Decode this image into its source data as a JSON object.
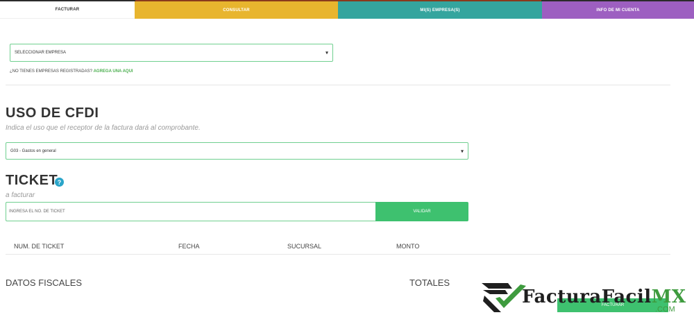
{
  "tabs": [
    {
      "label": "FACTURAR",
      "color": "#ffffff"
    },
    {
      "label": "CONSULTAR",
      "color": "#e8b52e"
    },
    {
      "label": "MI(S) EMPRESA(S)",
      "color": "#34a59e"
    },
    {
      "label": "INFO DE MI CUENTA",
      "color": "#9d5fc1"
    }
  ],
  "empresa": {
    "select_value": "SELECCIONAR EMPRESA",
    "no_empresas_text": "¿NO TIENES EMPRESAS REGISTRADAS?",
    "agrega_link": "AGREGA UNA AQUI"
  },
  "cfdi": {
    "title": "USO DE CFDI",
    "subtitle": "Indica el uso que el receptor de la factura dará al comprobante.",
    "select_value": "G03 - Gastos en general"
  },
  "ticket": {
    "title": "TICKET",
    "help_icon": "question-circle-icon",
    "help_glyph": "?",
    "subtitle": "a facturar",
    "input_placeholder": "INGRESA EL NO. DE TICKET",
    "validar_label": "VALIDAR"
  },
  "table": {
    "headers": [
      "NUM. DE TICKET",
      "FECHA",
      "SUCURSAL",
      "MONTO"
    ]
  },
  "sections": {
    "datos_fiscales": "DATOS FISCALES",
    "totales": "TOTALES"
  },
  "facturar_button": "FACTURAR",
  "logo": {
    "name_main": "FacturaFacil",
    "name_mx": "MX",
    "com": ".COM"
  },
  "colors": {
    "accent_green": "#3ec16f",
    "border_green": "#6fcf8f",
    "help_blue": "#2aa5c9"
  }
}
